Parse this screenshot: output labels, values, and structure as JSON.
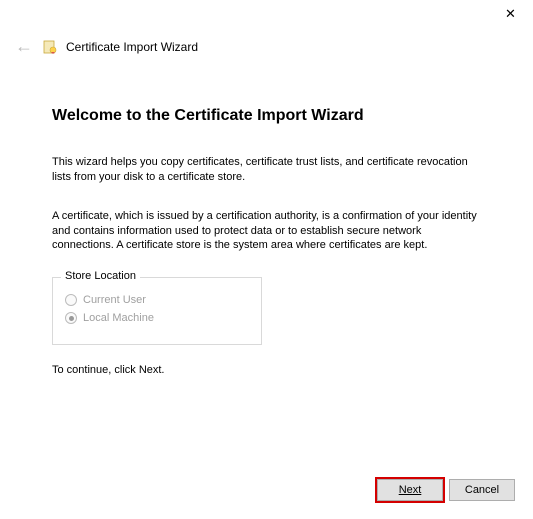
{
  "titlebar": {
    "close_glyph": "✕"
  },
  "header": {
    "back_glyph": "←",
    "title": "Certificate Import Wizard"
  },
  "main": {
    "heading": "Welcome to the Certificate Import Wizard",
    "paragraph1": "This wizard helps you copy certificates, certificate trust lists, and certificate revocation lists from your disk to a certificate store.",
    "paragraph2": "A certificate, which is issued by a certification authority, is a confirmation of your identity and contains information used to protect data or to establish secure network connections. A certificate store is the system area where certificates are kept.",
    "store_location": {
      "legend": "Store Location",
      "options": [
        {
          "label": "Current User",
          "selected": false
        },
        {
          "label": "Local Machine",
          "selected": true
        }
      ]
    },
    "continue_text": "To continue, click Next."
  },
  "buttons": {
    "next": "Next",
    "cancel": "Cancel"
  }
}
